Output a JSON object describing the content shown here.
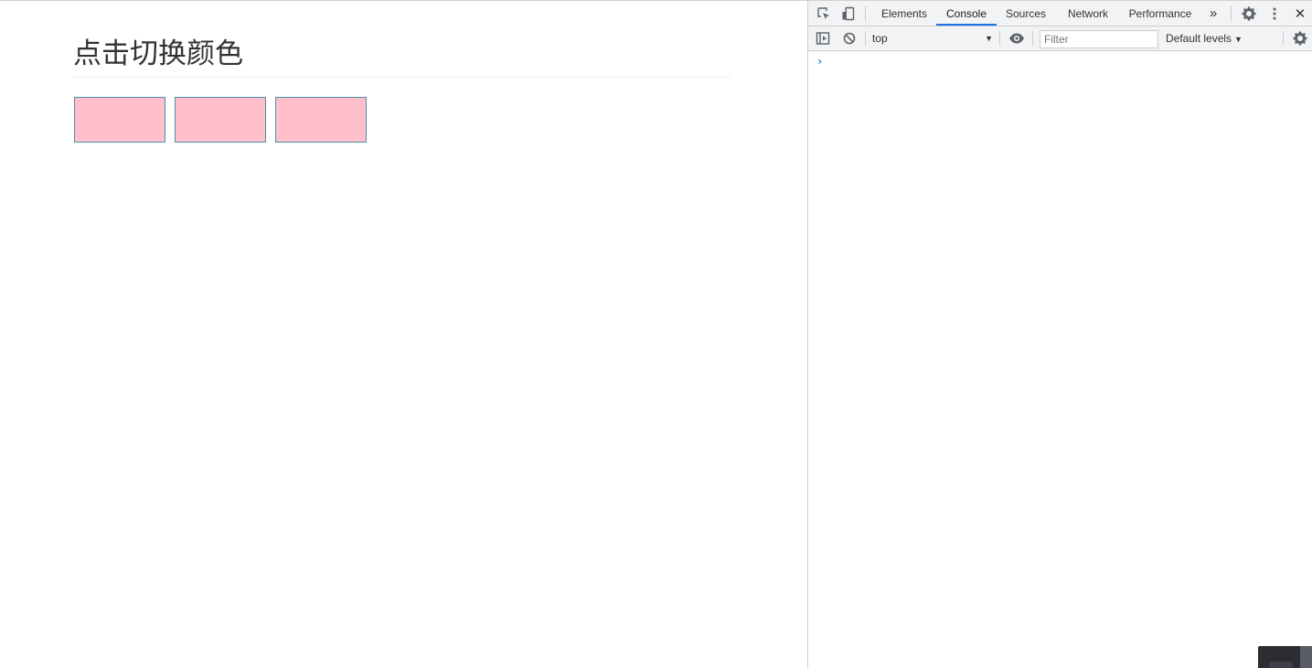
{
  "page": {
    "title": "点击切换颜色",
    "boxes": [
      {
        "color": "#ffc0cb",
        "border": "#4a90a8"
      },
      {
        "color": "#ffc0cb",
        "border": "#4a90a8"
      },
      {
        "color": "#ffc0cb",
        "border": "#4a90a8"
      }
    ]
  },
  "devtools": {
    "icons": {
      "inspect": "inspect-element-icon",
      "device": "device-toolbar-icon",
      "more_tabs": "»",
      "settings": "gear-icon",
      "menu": "kebab-menu-icon",
      "close": "✕"
    },
    "tabs": [
      {
        "label": "Elements",
        "active": false
      },
      {
        "label": "Console",
        "active": true
      },
      {
        "label": "Sources",
        "active": false
      },
      {
        "label": "Network",
        "active": false
      },
      {
        "label": "Performance",
        "active": false
      }
    ],
    "toolbar": {
      "context": "top",
      "filter_placeholder": "Filter",
      "filter_value": "",
      "levels_label": "Default levels"
    },
    "console": {
      "prompt_symbol": "›"
    },
    "accent": "#1a73e8"
  }
}
